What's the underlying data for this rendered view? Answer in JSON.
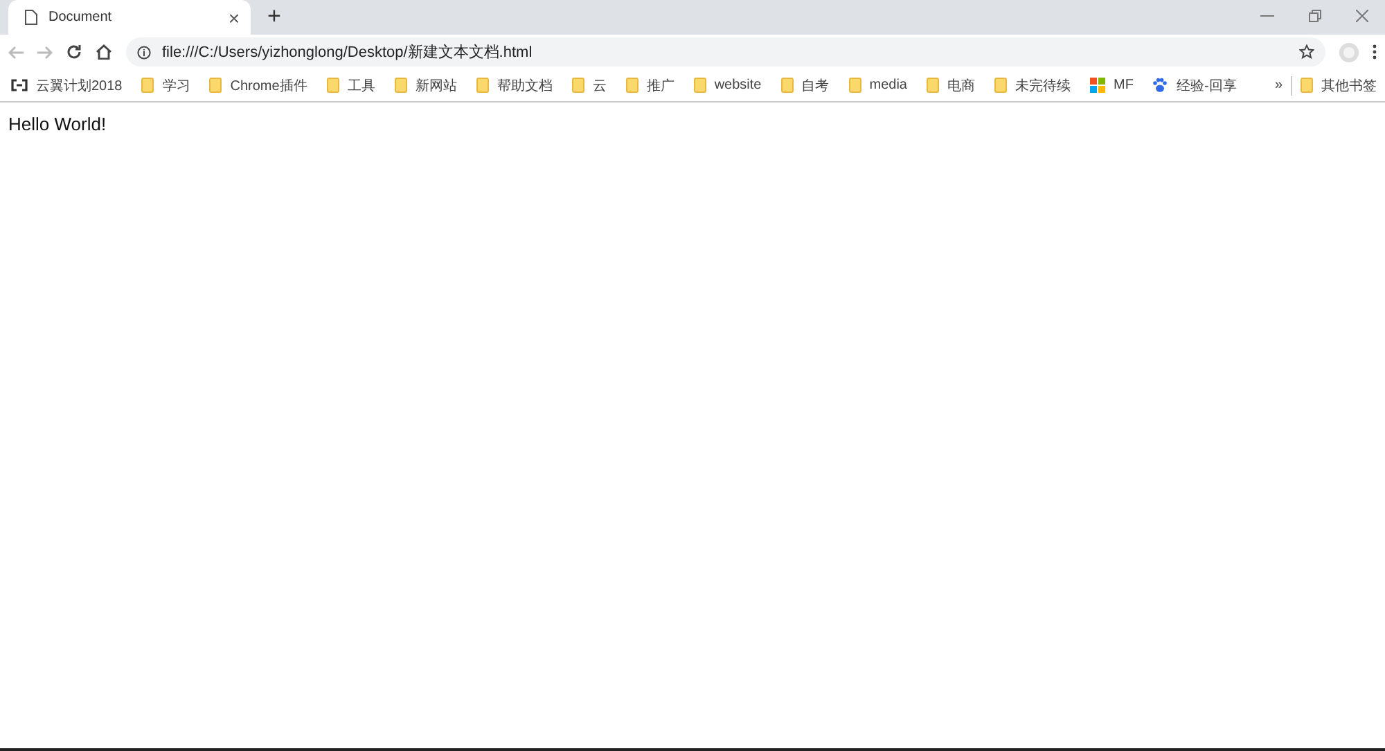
{
  "tab": {
    "title": "Document",
    "close": "×",
    "selected": true
  },
  "new_tab": "+",
  "address_bar": {
    "value": "file:///C:/Users/yizhonglong/Desktop/新建文本文档.html"
  },
  "bookmarks": [
    {
      "kind": "cloud",
      "label": "云翼计划2018"
    },
    {
      "kind": "folder",
      "label": "学习"
    },
    {
      "kind": "folder",
      "label": "Chrome插件"
    },
    {
      "kind": "folder",
      "label": "工具"
    },
    {
      "kind": "folder",
      "label": "新网站"
    },
    {
      "kind": "folder",
      "label": "帮助文档"
    },
    {
      "kind": "folder",
      "label": "云"
    },
    {
      "kind": "folder",
      "label": "推广"
    },
    {
      "kind": "folder",
      "label": "website"
    },
    {
      "kind": "folder",
      "label": "自考"
    },
    {
      "kind": "folder",
      "label": "media"
    },
    {
      "kind": "folder",
      "label": "电商"
    },
    {
      "kind": "folder",
      "label": "未完待续"
    },
    {
      "kind": "windows",
      "label": "MF"
    },
    {
      "kind": "paw",
      "label": "经验-回享"
    }
  ],
  "more_bookmarks": "»",
  "other_bookmarks": "其他书签",
  "page_text": "Hello World!"
}
